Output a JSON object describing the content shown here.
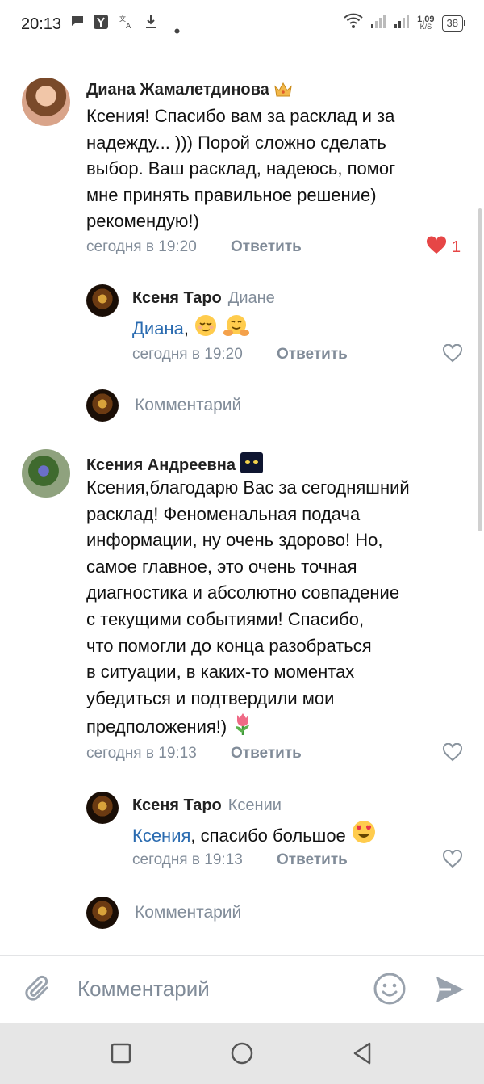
{
  "status_bar": {
    "time": "20:13",
    "speed_value": "1,09",
    "speed_unit": "K/S",
    "battery": "38"
  },
  "comments": [
    {
      "author": "Диана Жамалетдинова",
      "author_badge_icon": "crown-icon",
      "text_lines": [
        "Ксения! Спасибо вам за расклад и за",
        "надежду... ))) Порой сложно сделать",
        "выбор. Ваш расклад, надеюсь, помог",
        "мне принять правильное решение)",
        "рекомендую!)"
      ],
      "time": "сегодня в 19:20",
      "reply_label": "Ответить",
      "likes": "1",
      "liked": true
    },
    {
      "author": "Ксеня Таро",
      "reply_to": "Диане",
      "mention": "Диана",
      "after_mention": ",",
      "time": "сегодня в 19:20",
      "reply_label": "Ответить"
    },
    {
      "author": "Ксения Андреевна",
      "text_lines": [
        "Ксения,благодарю Вас за сегодняшний",
        "расклад! Феноменальная подача",
        "информации, ну очень здорово! Но,",
        "самое главное, это очень точная",
        "диагностика и абсолютно совпадение",
        "с текущими событиями! Спасибо,",
        "что помогли до конца разобраться",
        "в  ситуации, в каких-то моментах",
        "убедиться и подтвердили мои",
        "предположения!)"
      ],
      "time": "сегодня в 19:13",
      "reply_label": "Ответить"
    },
    {
      "author": "Ксеня Таро",
      "reply_to": "Ксении",
      "mention": "Ксения",
      "after_mention": ", спасибо большое",
      "time": "сегодня в 19:13",
      "reply_label": "Ответить"
    }
  ],
  "reply_input_placeholder": "Комментарий",
  "composer": {
    "placeholder": "Комментарий"
  },
  "colors": {
    "accent": "#2a6bb0",
    "secondary_text": "#818c99",
    "like_red": "#e64646"
  }
}
